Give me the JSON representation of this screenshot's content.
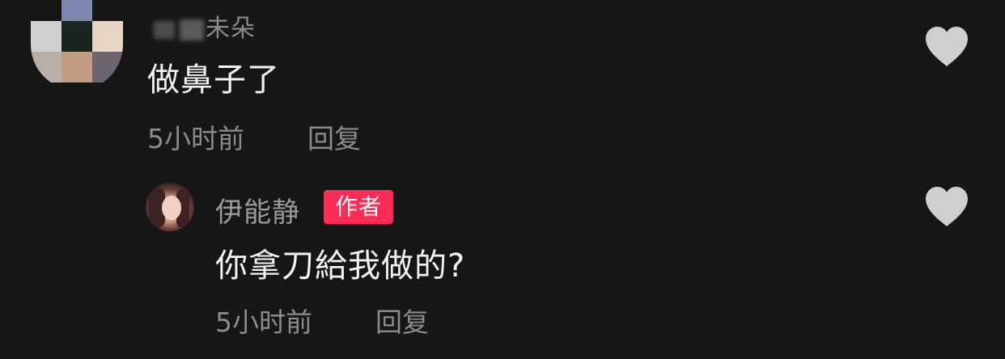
{
  "top_comment": {
    "username_visible": "朵",
    "username_partial": "未",
    "text": "做鼻子了",
    "time": "5小时前",
    "reply_label": "回复",
    "avatar_mosaic_colors": [
      "#7f86b0",
      "#cfcfcf",
      "#18241e",
      "#e6d5c3",
      "#b8b0a8",
      "#c29b84",
      "#6c6470"
    ]
  },
  "reply_comment": {
    "username": "伊能静",
    "badge": "作者",
    "text": "你拿刀給我做的?",
    "time": "5小时前",
    "reply_label": "回复"
  },
  "icons": {
    "like": "heart-icon"
  },
  "colors": {
    "background": "#161616",
    "badge": "#fe2c55",
    "muted_text": "#8b8b8b",
    "heart": "#cfcfcf"
  }
}
